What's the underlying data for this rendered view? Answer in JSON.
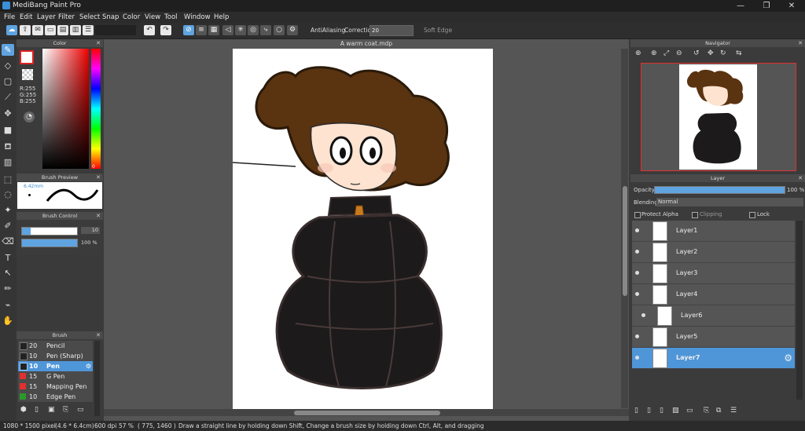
{
  "app": {
    "title": "MediBang Paint Pro"
  },
  "window_controls": {
    "minimize": "—",
    "maximize": "❐",
    "close": "✕"
  },
  "menu": [
    "File",
    "Edit",
    "Layer",
    "Filter",
    "Select",
    "Snap",
    "Color",
    "View",
    "Tool",
    "Window",
    "Help"
  ],
  "toolbar": {
    "antialiasing_label": "AntiAliasing",
    "correction_label": "Correction",
    "correction_value": "20",
    "soft_edge_label": "Soft Edge"
  },
  "color_panel": {
    "title": "Color",
    "r": "R:255",
    "g": "G:255",
    "b": "B:255",
    "hue_value": "0"
  },
  "brush_preview": {
    "title": "Brush Preview",
    "size": "6.42mm"
  },
  "brush_control": {
    "title": "Brush Control",
    "size_value": "10",
    "opacity_value": "100 %"
  },
  "brush_panel": {
    "title": "Brush",
    "items": [
      {
        "size": "20",
        "name": "Pencil",
        "color": "#222222"
      },
      {
        "size": "10",
        "name": "Pen (Sharp)",
        "color": "#222222"
      },
      {
        "size": "10",
        "name": "Pen",
        "color": "#222222"
      },
      {
        "size": "15",
        "name": "G Pen",
        "color": "#e03030"
      },
      {
        "size": "15",
        "name": "Mapping Pen",
        "color": "#e03030"
      },
      {
        "size": "10",
        "name": "Edge Pen",
        "color": "#2a9a2a"
      }
    ]
  },
  "document": {
    "title": "A warm coat.mdp"
  },
  "navigator": {
    "title": "Navigator"
  },
  "layer_panel": {
    "title": "Layer",
    "opacity_label": "Opacity",
    "opacity_value": "100 %",
    "blending_label": "Blending",
    "blending_value": "Normal",
    "protect_alpha": "Protect Alpha",
    "clipping": "Clipping",
    "lock": "Lock",
    "layers": [
      "Layer1",
      "Layer2",
      "Layer3",
      "Layer4",
      "Layer6",
      "Layer5",
      "Layer7"
    ]
  },
  "status": {
    "size": "1080 * 1500 pixel",
    "physical": "(4.6 * 6.4cm)",
    "dpi": "600 dpi",
    "zoom": "57 %",
    "cursor": "( 775, 1460 )",
    "hint": "Draw a straight line by holding down Shift, Change a brush size by holding down Ctrl, Alt, and dragging"
  },
  "colors": {
    "accent": "#4f96d8",
    "bg": "#3a3a3a",
    "coat": "#1c1a1a",
    "hair": "#5a3310"
  }
}
